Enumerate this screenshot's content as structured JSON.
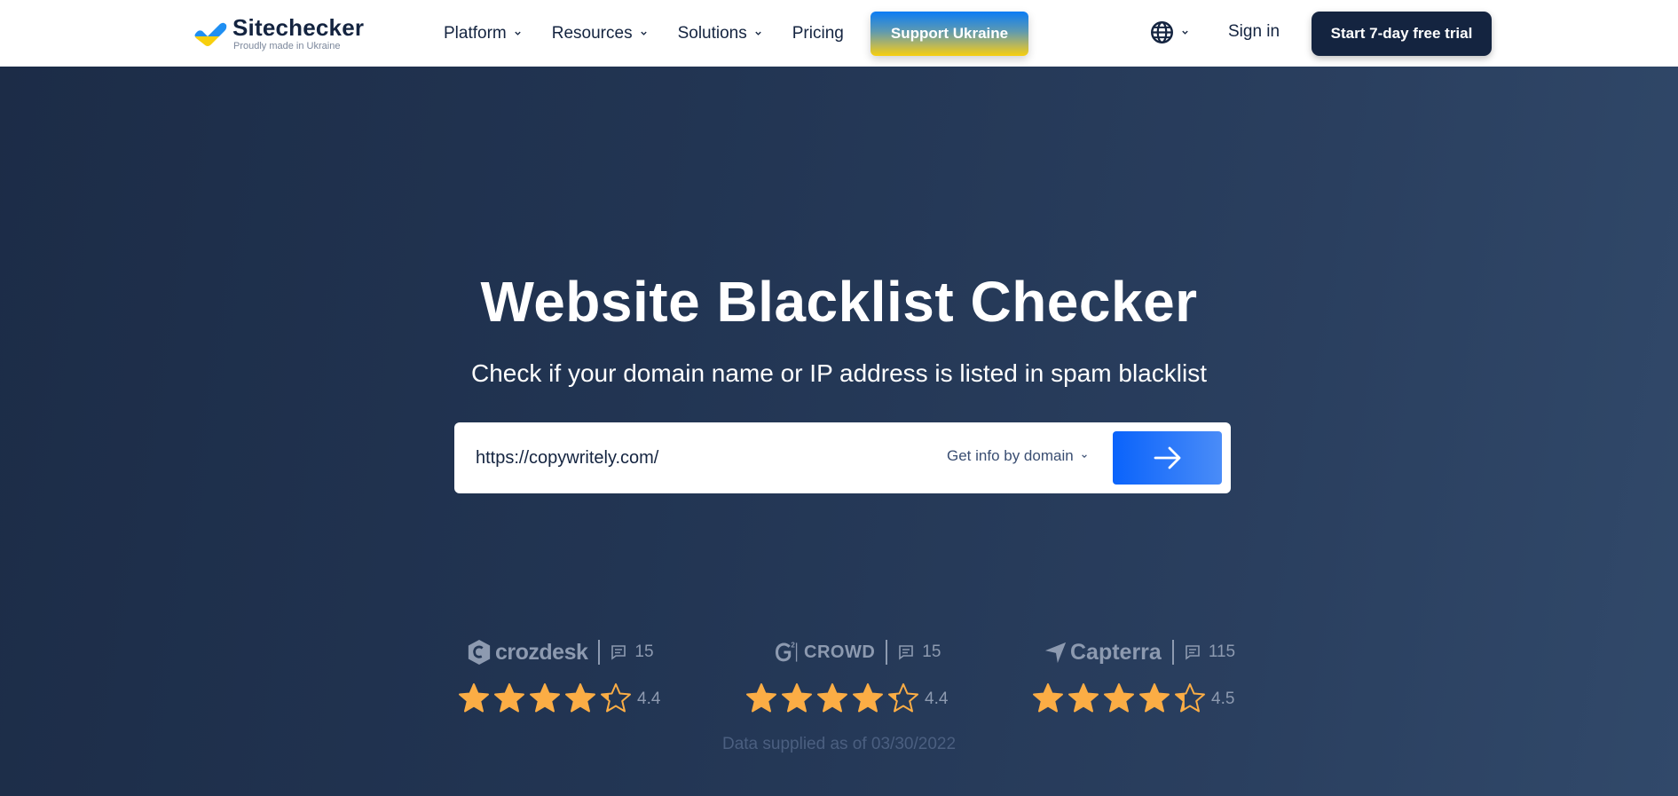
{
  "header": {
    "logo": {
      "name": "Sitechecker",
      "tagline": "Proudly made in Ukraine",
      "colors": {
        "top": "#1f8ff2",
        "bottom": "#f7cf0e"
      }
    },
    "nav": [
      {
        "label": "Platform",
        "has_dropdown": true
      },
      {
        "label": "Resources",
        "has_dropdown": true
      },
      {
        "label": "Solutions",
        "has_dropdown": true
      },
      {
        "label": "Pricing",
        "has_dropdown": false
      }
    ],
    "support_button": "Support Ukraine",
    "language_icon": "globe-icon",
    "sign_in": "Sign in",
    "trial_button": "Start 7-day free trial"
  },
  "hero": {
    "title": "Website Blacklist Checker",
    "subtitle": "Check if your domain name or IP address is listed in spam blacklist",
    "search": {
      "value": "https://copywritely.com/",
      "mode_select": "Get info by domain",
      "submit_icon": "arrow-right-icon",
      "accent": "#0a63fb"
    }
  },
  "ratings": [
    {
      "brand": "crozdesk",
      "reviews": "15",
      "score": "4.4",
      "stars": 4.4
    },
    {
      "brand": "CROWD",
      "brand_prefix": "G2",
      "reviews": "15",
      "score": "4.4",
      "stars": 4.4
    },
    {
      "brand": "Capterra",
      "reviews": "115",
      "score": "4.5",
      "stars": 4.5
    }
  ],
  "star_color": "#fbad45",
  "data_note": "Data supplied as of 03/30/2022"
}
